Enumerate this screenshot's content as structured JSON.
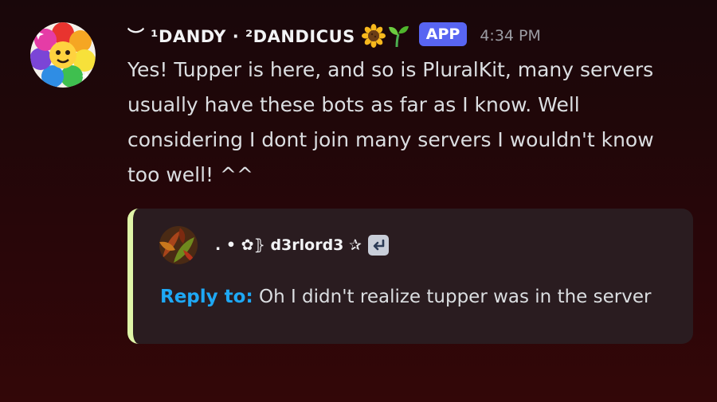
{
  "message": {
    "author": {
      "display_name": "︶ ¹DANDY · ²DANDICUS",
      "emojis": [
        "🌻",
        "🌱"
      ],
      "badge": "APP",
      "avatar": "rainbow-flower-avatar"
    },
    "timestamp": "4:34 PM",
    "content_lines": [
      "Yes! Tupper is here, and so is PluralKit, many servers",
      "usually have these bots as far as I know. Well",
      "considering I dont join many servers I wouldn't know",
      "too well!   ^^"
    ],
    "embed": {
      "accent_color": "#dff5a8",
      "author_name": ". • ✿⦄  d3rlord3 ✰",
      "author_avatar": "autumn-leaves-avatar",
      "jump_icon": "reply-arrow-icon",
      "reply_label": "Reply to:",
      "reply_text": "Oh I didn't realize tupper was in the server"
    }
  },
  "colors": {
    "app_badge": "#5865f2",
    "reply_label": "#1ea8f5",
    "timestamp": "#9b9ca3",
    "embed_background": "#2a1c20"
  }
}
